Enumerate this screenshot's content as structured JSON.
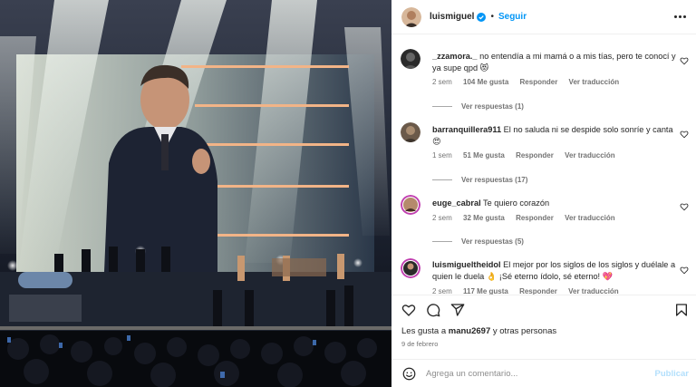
{
  "post": {
    "username": "luismiguel",
    "follow_label": "Seguir",
    "verified_icon": "verified-badge-icon",
    "more_icon": "more-options-icon"
  },
  "comments": [
    {
      "username": "_zzamora._",
      "text": "no entendía a mi mamá o a mis tías, pero te conocí y ya supe qpd 😻",
      "time": "2 sem",
      "likes": "104 Me gusta",
      "reply_label": "Responder",
      "translate_label": "Ver traducción",
      "replies_label": "Ver respuestas (1)"
    },
    {
      "username": "barranquillera911",
      "text": "El no saluda ni se despide solo sonríe y canta 😍",
      "time": "1 sem",
      "likes": "51 Me gusta",
      "reply_label": "Responder",
      "translate_label": "Ver traducción",
      "replies_label": "Ver respuestas (17)"
    },
    {
      "username": "euge_cabral",
      "text": "Te quiero corazón",
      "time": "2 sem",
      "likes": "32 Me gusta",
      "reply_label": "Responder",
      "translate_label": "Ver traducción",
      "replies_label": "Ver respuestas (5)"
    },
    {
      "username": "luismigueltheidol",
      "text": "El mejor por los siglos de los siglos y duélale a quien le duela 👌 ¡Sé eterno ídolo, sé eterno! 💖",
      "time": "2 sem",
      "likes": "117 Me gusta",
      "reply_label": "Responder",
      "translate_label": "Ver traducción"
    }
  ],
  "actions": {
    "like_icon": "heart-icon",
    "comment_icon": "comment-icon",
    "share_icon": "share-icon",
    "save_icon": "bookmark-icon"
  },
  "likes_text": {
    "prefix": "Les gusta a ",
    "user": "manu2697",
    "suffix": " y otras personas"
  },
  "date": "9 de febrero",
  "add_comment": {
    "placeholder": "Agrega un comentario...",
    "publish_label": "Publicar",
    "emoji_icon": "emoji-icon"
  },
  "colors": {
    "accent": "#0095f6",
    "heart_red": "#ed4956",
    "publish_disabled": "#b2dffc"
  }
}
